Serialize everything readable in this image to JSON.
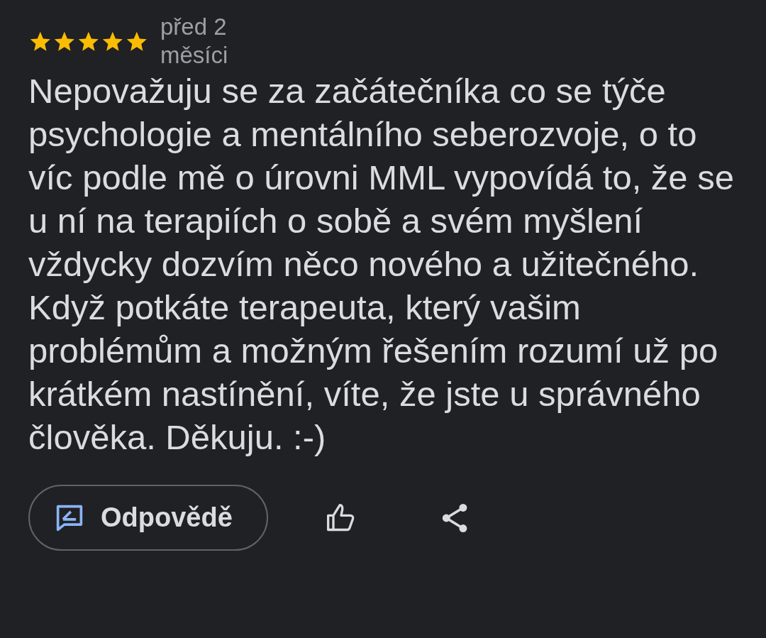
{
  "review": {
    "stars": 5,
    "time": "před 2 měsíci",
    "text": "Nepovažuju se za začátečníka co se týče psychologie a mentálního seberozvoje, o to víc podle mě o úrovni MML vypovídá to, že se u ní na terapiích o sobě a svém myšlení vždycky dozvím něco nového a užitečného. Když potkáte terapeuta, který vašim problémům a možným řešením rozumí už po krátkém nastínění, víte, že jste u správného člověka. Děkuju. :-)"
  },
  "actions": {
    "reply_label": "Odpovědě"
  }
}
